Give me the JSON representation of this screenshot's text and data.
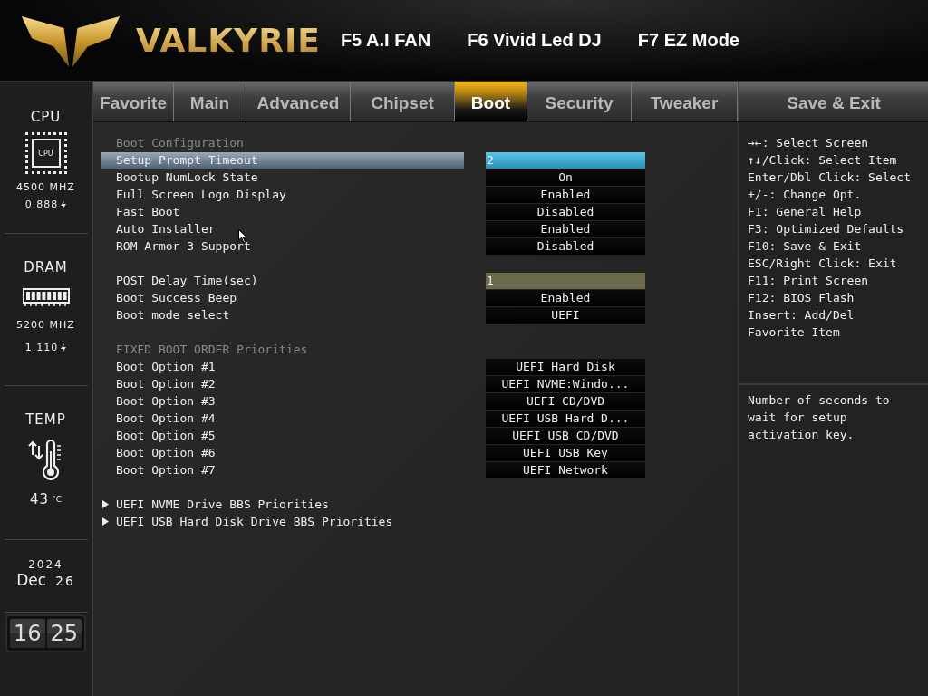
{
  "header": {
    "brand": "VALKYRIE",
    "hotkeys": [
      "F5 A.I FAN",
      "F6 Vivid Led DJ",
      "F7 EZ Mode"
    ]
  },
  "sidebar": {
    "cpu": {
      "label": "CPU",
      "chip_text": "CPU",
      "frequency": "4500 MHZ",
      "voltage": "0.888"
    },
    "dram": {
      "label": "DRAM",
      "frequency": "5200 MHZ",
      "voltage": "1.110"
    },
    "temp": {
      "label": "TEMP",
      "value": "43",
      "unit": "°C"
    },
    "date": {
      "year": "2024",
      "month": "Dec",
      "day": "26"
    },
    "clock": {
      "hour": "16",
      "minute": "25"
    }
  },
  "tabs": [
    {
      "label": "Favorite",
      "selected": false
    },
    {
      "label": "Main",
      "selected": false
    },
    {
      "label": "Advanced",
      "selected": false
    },
    {
      "label": "Chipset",
      "selected": false
    },
    {
      "label": "Boot",
      "selected": true
    },
    {
      "label": "Security",
      "selected": false
    },
    {
      "label": "Tweaker",
      "selected": false
    },
    {
      "label": "Save & Exit",
      "selected": false
    }
  ],
  "items": [
    {
      "kind": "header",
      "label": "Boot Configuration"
    },
    {
      "kind": "number",
      "label": "Setup Prompt Timeout",
      "value": "2",
      "selected": true
    },
    {
      "kind": "option",
      "label": "Bootup NumLock State",
      "value": "On",
      "selected": false
    },
    {
      "kind": "option",
      "label": "Full Screen Logo Display",
      "value": "Enabled",
      "selected": false
    },
    {
      "kind": "option",
      "label": "Fast Boot",
      "value": "Disabled",
      "selected": false
    },
    {
      "kind": "option",
      "label": "Auto Installer",
      "value": "Enabled",
      "selected": false
    },
    {
      "kind": "option",
      "label": "ROM Armor 3 Support",
      "value": "Disabled",
      "selected": false
    },
    {
      "kind": "gap"
    },
    {
      "kind": "number",
      "label": "POST Delay Time(sec)",
      "value": "1",
      "selected": false
    },
    {
      "kind": "option",
      "label": "Boot Success Beep",
      "value": "Enabled",
      "selected": false
    },
    {
      "kind": "option",
      "label": "Boot mode select",
      "value": "UEFI",
      "selected": false
    },
    {
      "kind": "gap"
    },
    {
      "kind": "header",
      "label": "FIXED BOOT ORDER Priorities"
    },
    {
      "kind": "option",
      "label": "Boot Option #1",
      "value": "UEFI Hard Disk",
      "selected": false
    },
    {
      "kind": "option",
      "label": "Boot Option #2",
      "value": "UEFI NVME:Windo...",
      "selected": false
    },
    {
      "kind": "option",
      "label": "Boot Option #3",
      "value": "UEFI CD/DVD",
      "selected": false
    },
    {
      "kind": "option",
      "label": "Boot Option #4",
      "value": "UEFI USB Hard D...",
      "selected": false
    },
    {
      "kind": "option",
      "label": "Boot Option #5",
      "value": "UEFI USB CD/DVD",
      "selected": false
    },
    {
      "kind": "option",
      "label": "Boot Option #6",
      "value": "UEFI USB Key",
      "selected": false
    },
    {
      "kind": "option",
      "label": "Boot Option #7",
      "value": "UEFI Network",
      "selected": false
    },
    {
      "kind": "gap"
    },
    {
      "kind": "submenu",
      "label": "UEFI NVME Drive BBS Priorities"
    },
    {
      "kind": "submenu",
      "label": "UEFI USB Hard Disk Drive BBS Priorities"
    }
  ],
  "help": {
    "keys": [
      "→←: Select Screen",
      "↑↓/Click: Select Item",
      "Enter/Dbl Click: Select",
      "+/-: Change Opt.",
      "F1: General Help",
      "F3: Optimized Defaults",
      "F10: Save & Exit",
      "ESC/Right Click: Exit",
      "F11: Print Screen",
      "F12: BIOS Flash",
      "Insert: Add/Del",
      "Favorite Item"
    ],
    "description": "Number of seconds to wait for setup activation key."
  }
}
